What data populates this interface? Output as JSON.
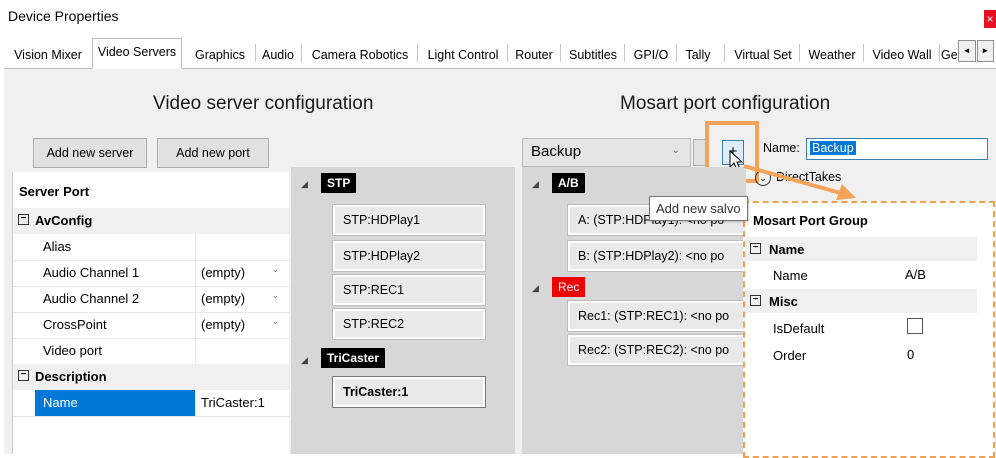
{
  "window": {
    "title": "Device Properties",
    "close_glyph": "×"
  },
  "tabs": [
    {
      "label": "Vision Mixer"
    },
    {
      "label": "Video Servers"
    },
    {
      "label": "Graphics"
    },
    {
      "label": "Audio"
    },
    {
      "label": "Camera Robotics"
    },
    {
      "label": "Light Control"
    },
    {
      "label": "Router"
    },
    {
      "label": "Subtitles"
    },
    {
      "label": "GPI/O"
    },
    {
      "label": "Tally"
    },
    {
      "label": "Virtual Set"
    },
    {
      "label": "Weather"
    },
    {
      "label": "Video Wall"
    },
    {
      "label": "Ge"
    }
  ],
  "active_tab": "Video Servers",
  "tab_scroll": {
    "left": "◄",
    "right": "►"
  },
  "video_server": {
    "heading": "Video server configuration",
    "add_server_label": "Add new server",
    "add_port_label": "Add new port",
    "grid": {
      "header": "Server Port",
      "categories": [
        {
          "name": "AvConfig",
          "expander": "−",
          "rows": [
            {
              "name": "Alias",
              "value": ""
            },
            {
              "name": "Audio Channel 1",
              "value": "(empty)",
              "combo": true
            },
            {
              "name": "Audio Channel 2",
              "value": "(empty)",
              "combo": true
            },
            {
              "name": "CrossPoint",
              "value": "(empty)",
              "combo": true
            },
            {
              "name": "Video port",
              "value": ""
            }
          ]
        },
        {
          "name": "Description",
          "expander": "−",
          "rows": [
            {
              "name": "Name",
              "value": "TriCaster:1",
              "selected": true
            }
          ]
        }
      ]
    },
    "servers": [
      {
        "name": "STP",
        "ports": [
          "STP:HDPlay1",
          "STP:HDPlay2",
          "STP:REC1",
          "STP:REC2"
        ]
      },
      {
        "name": "TriCaster",
        "ports": [
          "TriCaster:1"
        ]
      }
    ]
  },
  "mosart": {
    "heading": "Mosart port configuration",
    "selected_group": "Backup",
    "name_label": "Name:",
    "name_value": "Backup",
    "add_salvo_glyph": "+",
    "direct_takes_label": "DirectTakes",
    "tooltip": "Add new salvo",
    "groups": [
      {
        "name": "A/B",
        "color": "black",
        "ports": [
          "A: (STP:HDPlay1): <no po",
          "B: (STP:HDPlay2): <no po"
        ]
      },
      {
        "name": "Rec",
        "color": "red",
        "ports": [
          "Rec1: (STP:REC1): <no po",
          "Rec2: (STP:REC2): <no po"
        ]
      }
    ],
    "grid": {
      "header": "Mosart Port Group",
      "categories": [
        {
          "name": "Name",
          "expander": "−",
          "rows": [
            {
              "name": "Name",
              "value": "A/B"
            }
          ]
        },
        {
          "name": "Misc",
          "expander": "−",
          "rows": [
            {
              "name": "IsDefault",
              "value": "",
              "checkbox": true
            },
            {
              "name": "Order",
              "value": "0"
            }
          ]
        }
      ]
    }
  },
  "icons": {
    "combo": "chevron-down-icon",
    "tree_expanded": "triangle-down-icon",
    "cursor": "mouse-pointer-icon",
    "direct_takes": "circle-chevron-icon"
  },
  "colors": {
    "accent": "#0078d7",
    "highlight": "#f4a45a",
    "red_group": "#e00000"
  }
}
